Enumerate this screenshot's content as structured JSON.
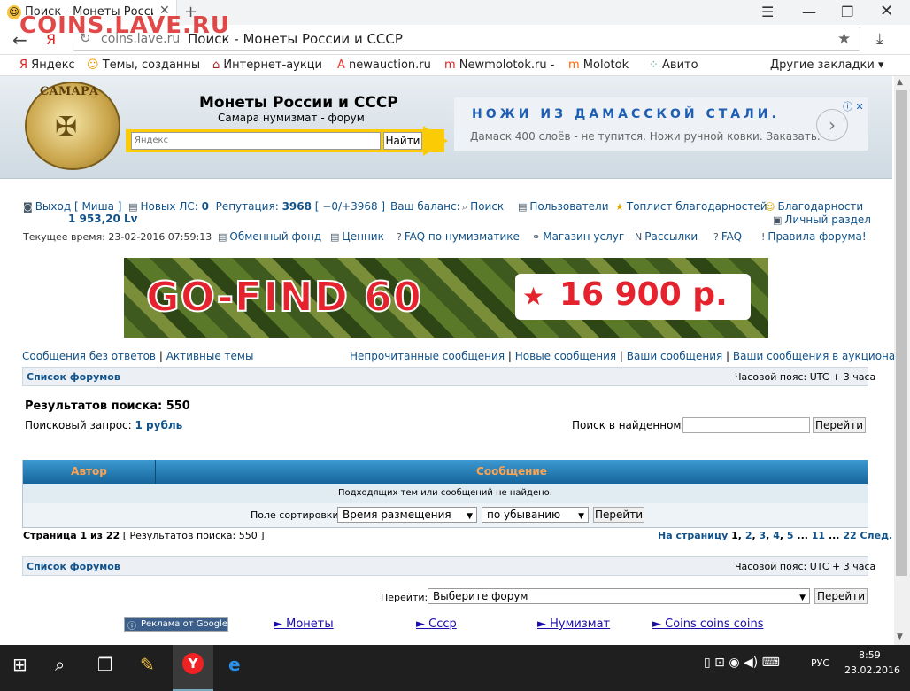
{
  "browser": {
    "tab_title": "Поиск - Монеты Росси",
    "watermark": "COINS.LAVE.RU",
    "domain": "coins.lave.ru",
    "page_title": "Поиск - Монеты России и СССР",
    "bookmarks": [
      "Яндекс",
      "Темы, созданны",
      "Интернет-аукци",
      "newauction.ru",
      "Newmolotok.ru -",
      "Molotok",
      "Авито"
    ],
    "other_bookmarks": "Другие закладки"
  },
  "header": {
    "logo_text": "САМАРА",
    "site_title": "Монеты России и СССР",
    "site_subtitle": "Самара нумизмат - форум",
    "search_placeholder": "Яндекс",
    "search_button": "Найти"
  },
  "ad_top": {
    "headline": "НОЖИ ИЗ ДАМАССКОЙ СТАЛИ.",
    "desc": "Дамаск 400 слоёв - не тупится. Ножи ручной ковки. Заказать."
  },
  "user": {
    "logout": "Выход [ Миша ]",
    "new_pm_label": "Новых ЛС:",
    "new_pm_count": "0",
    "rep_label": "Репутация:",
    "rep_value": "3968",
    "rep_detail": "[ −0/+3968 ]",
    "balance_label": "Ваш баланс:",
    "balance_value": "1 953,20 Lv",
    "time": "Текущее время: 23-02-2016 07:59:13"
  },
  "nav_right": [
    "Поиск",
    "Пользователи",
    "Топлист благодарностей",
    "Благодарности"
  ],
  "nav_personal": "Личный раздел",
  "nav_row2": [
    "Обменный фонд",
    "Ценник",
    "FAQ по нумизматике",
    "Магазин услуг",
    "Рассылки",
    "FAQ",
    "Правила форума!"
  ],
  "banner": {
    "text": "GO-FIND 60",
    "price": "16 900 р."
  },
  "links_left": [
    "Сообщения без ответов",
    "Активные темы"
  ],
  "links_right": [
    "Непрочитанные сообщения",
    "Новые сообщения",
    "Ваши сообщения",
    "Ваши сообщения в аукционах"
  ],
  "sep": "|",
  "forum_list": "Список форумов",
  "timezone": "Часовой пояс: UTC + 3 часа",
  "results": {
    "title": "Результатов поиска: 550",
    "query_label": "Поисковый запрос:",
    "query_value": "1 рубль",
    "search_in_label": "Поиск в найденном:",
    "go_button": "Перейти"
  },
  "table": {
    "col_author": "Автор",
    "col_message": "Сообщение",
    "empty": "Подходящих тем или сообщений не найдено.",
    "sort_label": "Поле сортировки:",
    "sort_field": "Время размещения",
    "sort_order": "по убыванию",
    "sort_button": "Перейти"
  },
  "pagination": {
    "page_info": "Страница 1 из 22",
    "count_info": "[ Результатов поиска: 550 ]",
    "to_page": "На страницу",
    "pages": [
      "1",
      "2",
      "3",
      "4",
      "5",
      "...",
      "11",
      "...",
      "22"
    ],
    "next": "След."
  },
  "jump": {
    "label": "Перейти:",
    "select": "Выберите форум",
    "button": "Перейти"
  },
  "google_ads": {
    "label": "Реклама от Google",
    "links": [
      "► Монеты",
      "► Ссср",
      "► Нумизмат",
      "► Coins coins coins"
    ]
  },
  "taskbar": {
    "lang": "РУС",
    "time": "8:59",
    "date": "23.02.2016"
  },
  "colors": {
    "link": "#105289",
    "th_bg": "#15659b",
    "th_text": "#ffa34f",
    "yandex_yellow": "#fbcb05"
  }
}
